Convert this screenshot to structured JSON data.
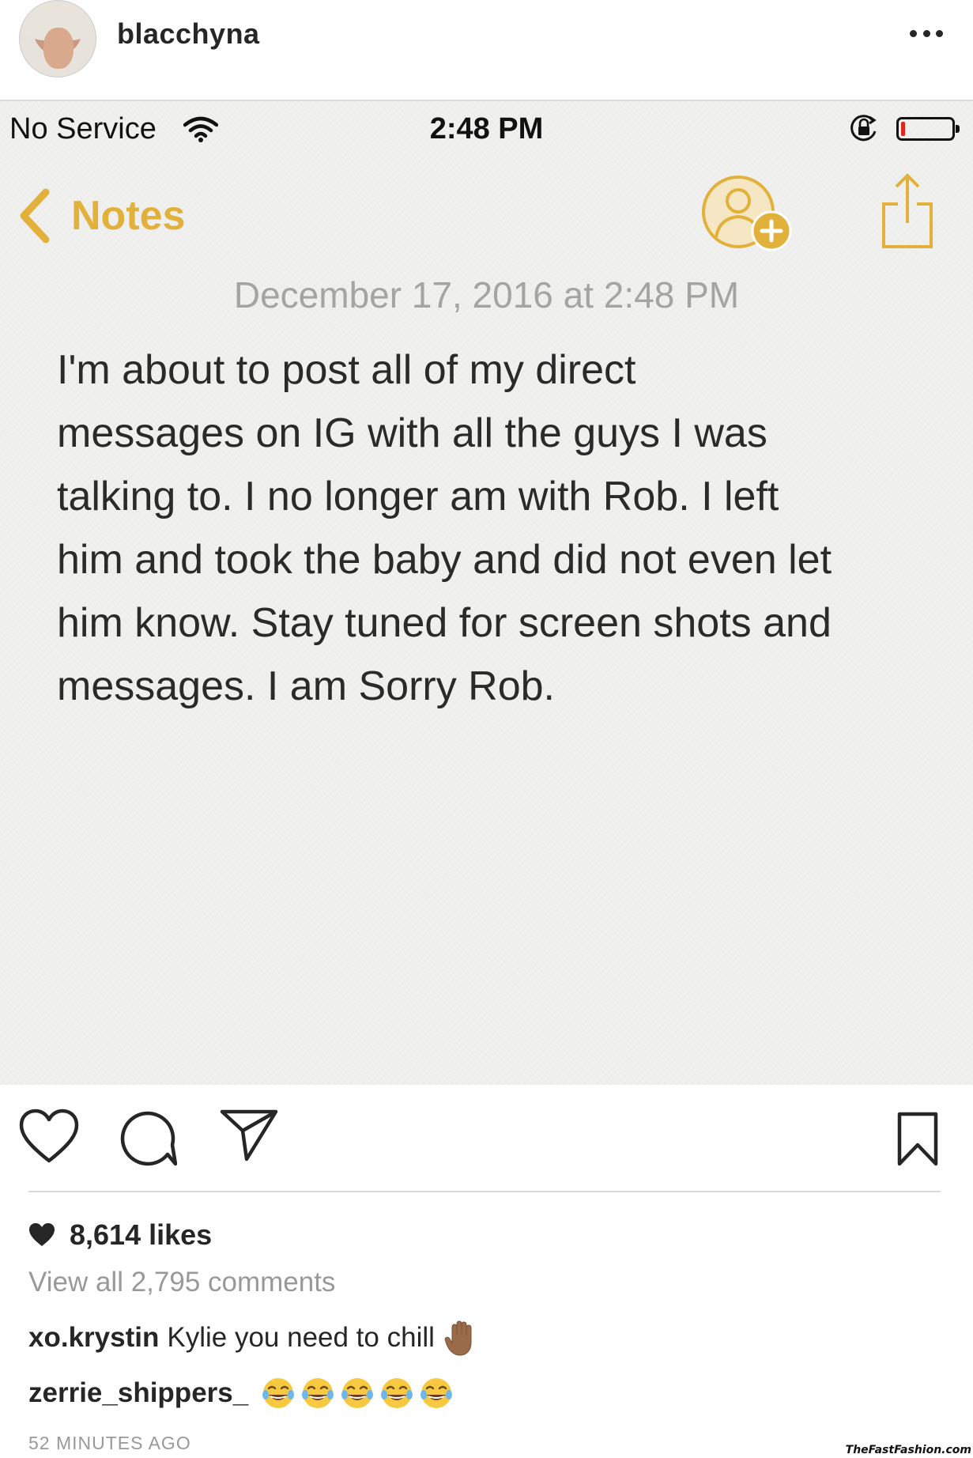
{
  "post": {
    "username": "blacchyna"
  },
  "status_bar": {
    "carrier": "No Service",
    "time": "2:48 PM",
    "battery_level": 0.08,
    "colors": {
      "battery_low": "#e0271b"
    }
  },
  "notes": {
    "back_label": "Notes",
    "date": "December 17, 2016 at 2:48 PM",
    "body": "I'm about to post all of my direct\nmessages on IG with all the guys I was\ntalking to. I no longer am with Rob. I left\nhim and took the baby and did not even let\nhim know. Stay tuned for screen shots and\nmessages. I am Sorry Rob.",
    "colors": {
      "accent": "#e2b13c",
      "background": "#f1f1f0"
    },
    "icons": [
      "chevron-left-icon",
      "add-person-icon",
      "share-icon"
    ]
  },
  "actions": {
    "icons": [
      "heart-icon",
      "comment-icon",
      "direct-icon",
      "bookmark-icon"
    ]
  },
  "meta": {
    "likes": "8,614 likes",
    "view_comments": "View all 2,795 comments",
    "comments": [
      {
        "user": "xo.krystin",
        "text": "Kylie you need to chill"
      },
      {
        "user": "zerrie_shippers_",
        "text": ""
      }
    ],
    "timestamp": "52 MINUTES AGO"
  },
  "watermark": "TheFastFashion.com"
}
